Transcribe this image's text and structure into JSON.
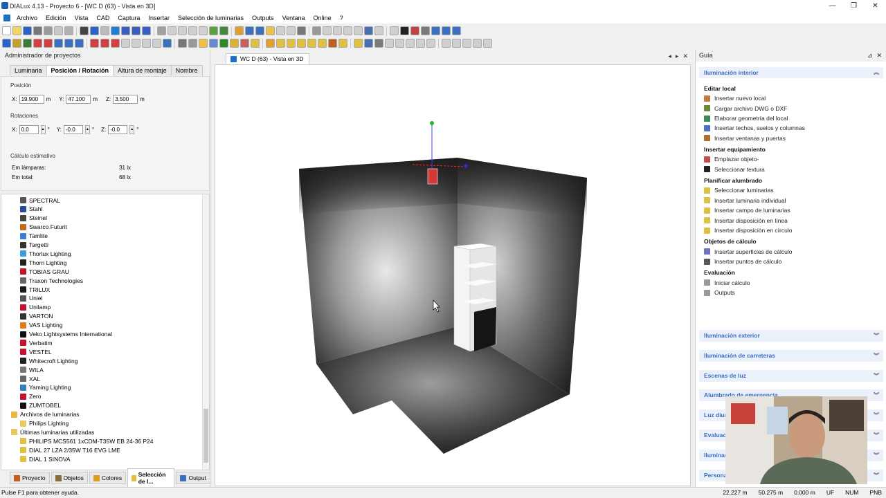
{
  "window": {
    "title": "DIALux 4.13 - Proyecto 6 - [WC D (63) - Vista en 3D]",
    "controls": [
      "—",
      "❐",
      "✕"
    ]
  },
  "menu": [
    "Archivo",
    "Edición",
    "Vista",
    "CAD",
    "Captura",
    "Insertar",
    "Selección de luminarias",
    "Outputs",
    "Ventana",
    "Online",
    "?"
  ],
  "left_panel": {
    "title": "Administrador de proyectos",
    "tabs": [
      "Luminaria",
      "Posición / Rotación",
      "Altura de montaje",
      "Nombre"
    ],
    "position": {
      "heading": "Posición",
      "x_label": "X:",
      "x_value": "19.900",
      "y_label": "Y:",
      "y_value": "47.100",
      "z_label": "Z:",
      "z_value": "3.500",
      "unit": "m"
    },
    "rotation": {
      "heading": "Rotaciones",
      "x_label": "X:",
      "x_value": "0.0",
      "y_label": "Y:",
      "y_value": "-0.0",
      "z_label": "Z:",
      "z_value": "-0.0",
      "unit": "°"
    },
    "estimate": {
      "heading": "Cálculo estimativo",
      "lamps_label": "Em lámparas:",
      "lamps_value": "31 lx",
      "total_label": "Em total:",
      "total_value": "68 lx"
    },
    "tree": [
      {
        "label": "SPECTRAL",
        "color": "#555555"
      },
      {
        "label": "Stahl",
        "color": "#2a4b9a"
      },
      {
        "label": "Steinel",
        "color": "#444444"
      },
      {
        "label": "Swarco Futurit",
        "color": "#c06a1a"
      },
      {
        "label": "Tamlite",
        "color": "#3a7fd0"
      },
      {
        "label": "Targetti",
        "color": "#333333"
      },
      {
        "label": "Thorlux Lighting",
        "color": "#3a9fd8"
      },
      {
        "label": "Thorn Lighting",
        "color": "#222222"
      },
      {
        "label": "TOBIAS GRAU",
        "color": "#c3122c"
      },
      {
        "label": "Traxon Technologies",
        "color": "#666666"
      },
      {
        "label": "TRILUX",
        "color": "#1a1a1a"
      },
      {
        "label": "Uniel",
        "color": "#555555"
      },
      {
        "label": "Unilamp",
        "color": "#c8102e"
      },
      {
        "label": "VARTON",
        "color": "#333333"
      },
      {
        "label": "VAS Lighting",
        "color": "#e07b1a"
      },
      {
        "label": "Veko Lightsystems International",
        "color": "#111111"
      },
      {
        "label": "Verbatim",
        "color": "#c8102e"
      },
      {
        "label": "VESTEL",
        "color": "#c8102e"
      },
      {
        "label": "Whitecroft Lighting",
        "color": "#222222"
      },
      {
        "label": "WILA",
        "color": "#777777"
      },
      {
        "label": "XAL",
        "color": "#666666"
      },
      {
        "label": "Yaming Lighting",
        "color": "#2f7fc1"
      },
      {
        "label": "Zero",
        "color": "#c8102e"
      },
      {
        "label": "ZUMTOBEL",
        "color": "#111111"
      }
    ],
    "archive": {
      "label": "Archivos de luminarias",
      "child": "Philips Lighting"
    },
    "recent": {
      "label": "Últimas luminarias utilizadas",
      "items": [
        "PHILIPS MCS561 1xCDM-T35W EB 24-36 P24",
        "DIAL 27 LZA 2/35W T16 EVG LME",
        "DIAL 1 SINOVA"
      ]
    },
    "bottom_tabs": [
      "Proyecto",
      "Objetos",
      "Colores",
      "Selección de l...",
      "Output"
    ]
  },
  "viewport": {
    "tab": "WC D (63) - Vista en 3D",
    "controls": [
      "◂",
      "▸",
      "✕"
    ]
  },
  "guide": {
    "title": "Guía",
    "section": "Iluminación interior",
    "groups": [
      {
        "title": "Editar local",
        "items": [
          "Insertar nuevo local",
          "Cargar archivo DWG o DXF",
          "Elaborar geometría del local",
          "Insertar techos, suelos y columnas",
          "Insertar ventanas y puertas"
        ]
      },
      {
        "title": "Insertar equipamiento",
        "items": [
          "Emplazar objeto-",
          "Seleccionar textura"
        ]
      },
      {
        "title": "Planificar alumbrado",
        "items": [
          "Seleccionar luminarias",
          "Insertar luminaria individual",
          "Insertar campo de luminarias",
          "Insertar disposición en línea",
          "Insertar disposición en círculo"
        ]
      },
      {
        "title": "Objetos de cálculo",
        "items": [
          "Insertar superficies de cálculo",
          "Insertar puntos de cálculo"
        ]
      },
      {
        "title": "Evaluación",
        "items": [
          "Iniciar cálculo",
          "Outputs"
        ]
      }
    ],
    "collapsed": [
      "Iluminación exterior",
      "Iluminación de carreteras",
      "Escenas de luz",
      "Alumbrado de emergencia",
      "Luz diurna",
      "Evaluación",
      "Iluminación",
      "Personal"
    ]
  },
  "status": {
    "hint": "Pulse F1 para obtener ayuda.",
    "coords": [
      "22.227 m",
      "50.275 m",
      "0.000 m",
      "UF",
      "NUM",
      "PNB"
    ]
  }
}
